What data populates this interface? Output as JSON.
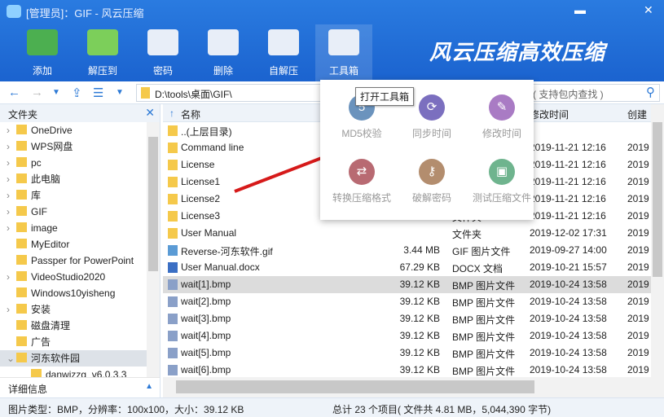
{
  "window": {
    "title": "[管理员]：GIF - 风云压缩",
    "minimize": "▬",
    "close": "✕"
  },
  "toolbar": [
    {
      "label": "添加",
      "color": "#4caf50"
    },
    {
      "label": "解压到",
      "color": "#7ccf5a"
    },
    {
      "label": "密码",
      "color": "#e8eef8"
    },
    {
      "label": "删除",
      "color": "#e8eef8"
    },
    {
      "label": "自解压",
      "color": "#e8eef8"
    },
    {
      "label": "工具箱",
      "color": "#e8eef8"
    }
  ],
  "brand": "风云压缩高效压缩",
  "nav": {
    "path": "D:\\tools\\桌面\\GIF\\",
    "search_placeholder": "( 支持包内查找 )"
  },
  "sidebar": {
    "title": "文件夹",
    "items": [
      "OneDrive",
      "WPS网盘",
      "pc",
      "此电脑",
      "库",
      "GIF",
      "image",
      "MyEditor",
      "Passper for PowerPoint",
      "VideoStudio2020",
      "Windows10yisheng",
      "安装",
      "磁盘清理",
      "广告",
      "河东软件园",
      "danwizzg_v6.0.3.3"
    ],
    "details": "详细信息"
  },
  "columns": [
    "名称",
    "修改时间",
    "创建"
  ],
  "files": [
    {
      "name": "..(上层目录)",
      "size": "",
      "type": "",
      "modified": "",
      "created": ""
    },
    {
      "name": "Command line",
      "size": "",
      "type": "",
      "modified": "2019-11-21 12:16",
      "created": "2019"
    },
    {
      "name": "License",
      "size": "",
      "type": "",
      "modified": "2019-11-21 12:16",
      "created": "2019"
    },
    {
      "name": "License1",
      "size": "",
      "type": "",
      "modified": "2019-11-21 12:16",
      "created": "2019"
    },
    {
      "name": "License2",
      "size": "",
      "type": "",
      "modified": "2019-11-21 12:16",
      "created": "2019"
    },
    {
      "name": "License3",
      "size": "",
      "type": "文件夹",
      "modified": "2019-11-21 12:16",
      "created": "2019"
    },
    {
      "name": "User Manual",
      "size": "",
      "type": "文件夹",
      "modified": "2019-12-02 17:31",
      "created": "2019"
    },
    {
      "name": "Reverse-河东软件.gif",
      "size": "3.44 MB",
      "type": "GIF 图片文件",
      "modified": "2019-09-27 14:00",
      "created": "2019"
    },
    {
      "name": "User Manual.docx",
      "size": "67.29 KB",
      "type": "DOCX 文档",
      "modified": "2019-10-21 15:57",
      "created": "2019"
    },
    {
      "name": "wait[1].bmp",
      "size": "39.12 KB",
      "type": "BMP 图片文件",
      "modified": "2019-10-24 13:58",
      "created": "2019"
    },
    {
      "name": "wait[2].bmp",
      "size": "39.12 KB",
      "type": "BMP 图片文件",
      "modified": "2019-10-24 13:58",
      "created": "2019"
    },
    {
      "name": "wait[3].bmp",
      "size": "39.12 KB",
      "type": "BMP 图片文件",
      "modified": "2019-10-24 13:58",
      "created": "2019"
    },
    {
      "name": "wait[4].bmp",
      "size": "39.12 KB",
      "type": "BMP 图片文件",
      "modified": "2019-10-24 13:58",
      "created": "2019"
    },
    {
      "name": "wait[5].bmp",
      "size": "39.12 KB",
      "type": "BMP 图片文件",
      "modified": "2019-10-24 13:58",
      "created": "2019"
    },
    {
      "name": "wait[6].bmp",
      "size": "39.12 KB",
      "type": "BMP 图片文件",
      "modified": "2019-10-24 13:58",
      "created": "2019"
    }
  ],
  "toolbox": {
    "tooltip": "打开工具箱",
    "tools": [
      {
        "label": "MD5校验",
        "color": "#6b93bd",
        "glyph": "5"
      },
      {
        "label": "同步时间",
        "color": "#7b6fbf",
        "glyph": "⟳"
      },
      {
        "label": "修改时间",
        "color": "#a97bc4",
        "glyph": "✎"
      },
      {
        "label": "转换压缩格式",
        "color": "#b86a72",
        "glyph": "⇄"
      },
      {
        "label": "破解密码",
        "color": "#b38d6e",
        "glyph": "⚷"
      },
      {
        "label": "测试压缩文件",
        "color": "#6fb48e",
        "glyph": "▣"
      }
    ]
  },
  "status": {
    "left": "图片类型：BMP，分辨率：100x100，大小：39.12 KB",
    "right": "总计 23 个项目( 文件共 4.81 MB，5,044,390 字节)"
  }
}
